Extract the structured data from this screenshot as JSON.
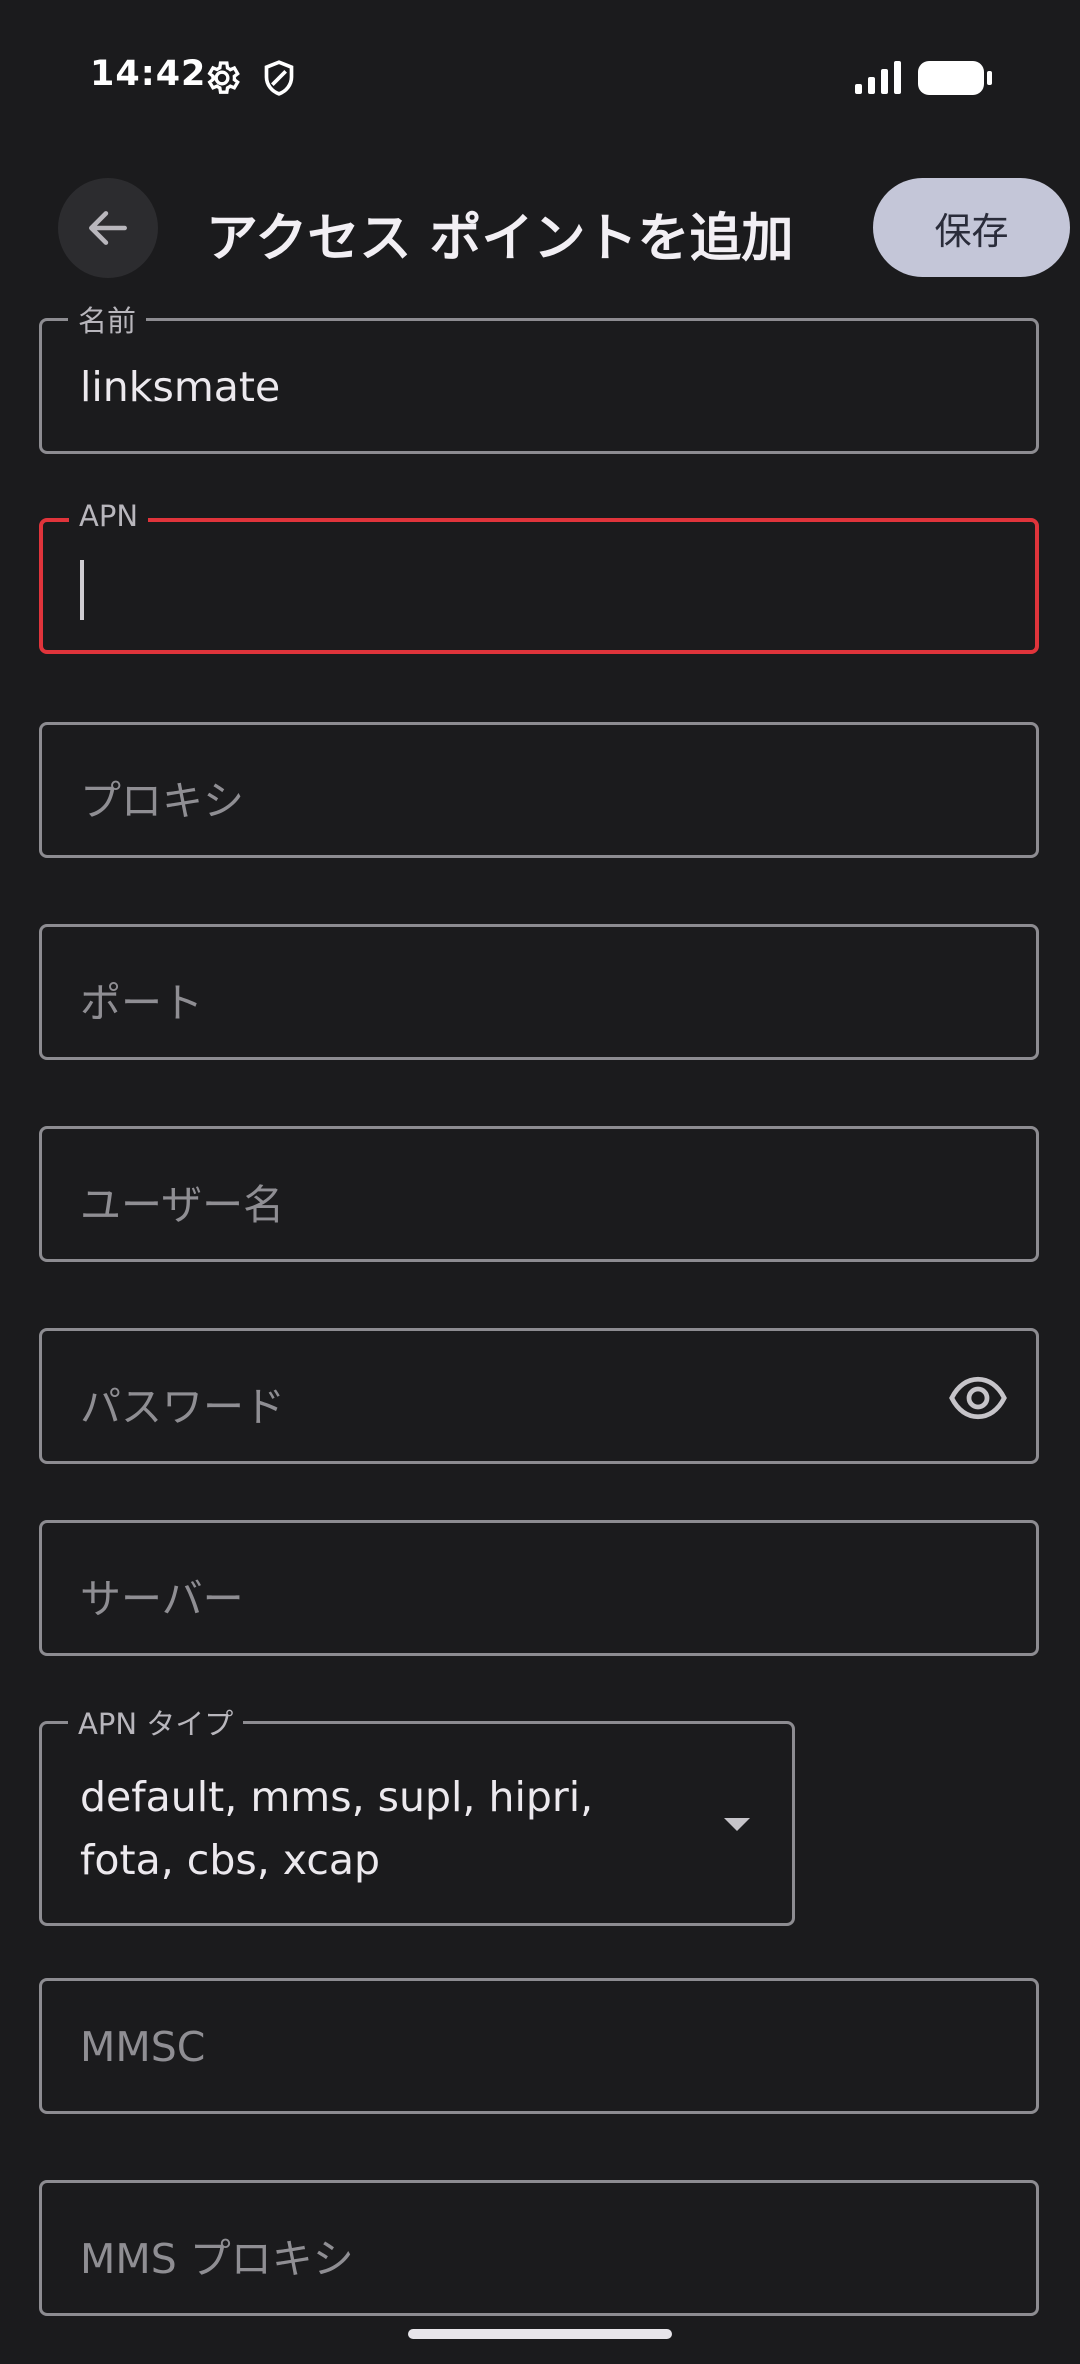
{
  "status_bar": {
    "time": "14:42",
    "icons": [
      "gear-icon",
      "shield-icon",
      "signal-icon",
      "battery-icon"
    ]
  },
  "app_bar": {
    "back_icon": "arrow-left-icon",
    "title": "アクセス ポイントを追加",
    "save_label": "保存"
  },
  "fields": {
    "name": {
      "label": "名前",
      "value": "linksmate"
    },
    "apn": {
      "label": "APN",
      "value": ""
    },
    "proxy": {
      "placeholder": "プロキシ"
    },
    "port": {
      "placeholder": "ポート"
    },
    "username": {
      "placeholder": "ユーザー名"
    },
    "password": {
      "placeholder": "パスワード",
      "toggle_icon": "eye-icon"
    },
    "server": {
      "placeholder": "サーバー"
    },
    "apn_type": {
      "label": "APN タイプ",
      "value": "default, mms, supl, hipri, fota, cbs, xcap"
    },
    "mmsc": {
      "placeholder": "MMSC"
    },
    "mms_proxy": {
      "placeholder": "MMS プロキシ"
    }
  },
  "colors": {
    "background": "#1b1b1d",
    "field_border": "#8d8c91",
    "active_border": "#e0343b",
    "save_button": "#c4c6d8"
  }
}
